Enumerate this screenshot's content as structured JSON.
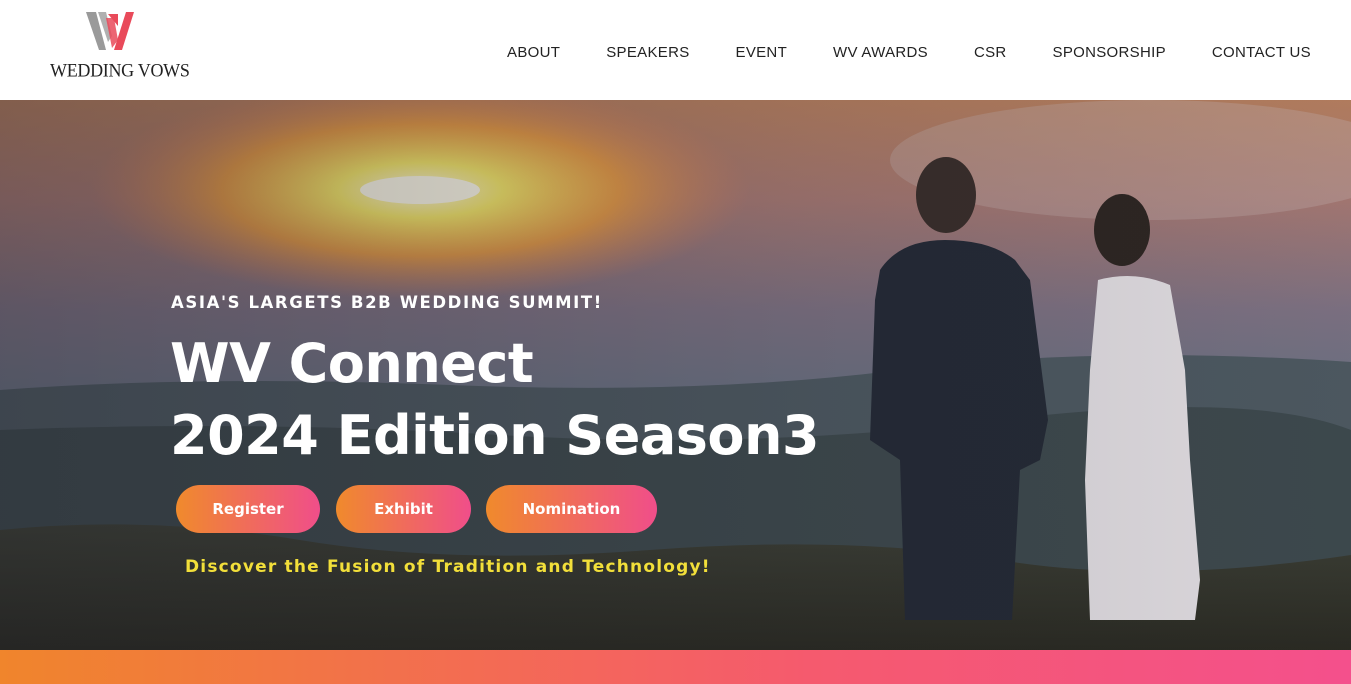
{
  "brand": {
    "name": "WEDDING VOWS",
    "mark_colors": {
      "primary": "#e94a5a",
      "secondary": "#9a9a9a"
    }
  },
  "nav": {
    "items": [
      {
        "label": "ABOUT"
      },
      {
        "label": "SPEAKERS"
      },
      {
        "label": "EVENT"
      },
      {
        "label": "WV AWARDS"
      },
      {
        "label": "CSR"
      },
      {
        "label": "SPONSORSHIP"
      },
      {
        "label": "CONTACT US"
      }
    ]
  },
  "hero": {
    "eyebrow": "ASIA'S LARGETS B2B WEDDING SUMMIT!",
    "title_line1": "WV Connect",
    "title_line2": "2024 Edition Season3",
    "buttons": {
      "register": "Register",
      "exhibit": "Exhibit",
      "nomination": "Nomination"
    },
    "tagline": "Discover the Fusion of Tradition and Technology!"
  },
  "colors": {
    "button_gradient_start": "#f08a2c",
    "button_gradient_end": "#f04e8a",
    "tagline": "#f2df3a"
  }
}
